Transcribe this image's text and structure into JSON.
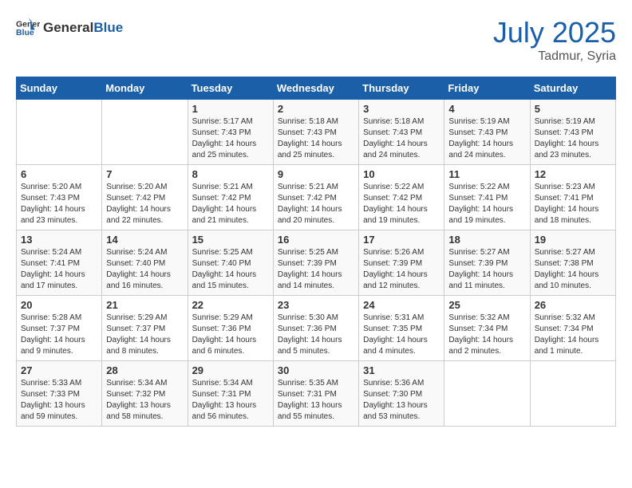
{
  "header": {
    "logo_general": "General",
    "logo_blue": "Blue",
    "month_year": "July 2025",
    "location": "Tadmur, Syria"
  },
  "days_of_week": [
    "Sunday",
    "Monday",
    "Tuesday",
    "Wednesday",
    "Thursday",
    "Friday",
    "Saturday"
  ],
  "weeks": [
    [
      {
        "day": "",
        "sunrise": "",
        "sunset": "",
        "daylight": ""
      },
      {
        "day": "",
        "sunrise": "",
        "sunset": "",
        "daylight": ""
      },
      {
        "day": "1",
        "sunrise": "Sunrise: 5:17 AM",
        "sunset": "Sunset: 7:43 PM",
        "daylight": "Daylight: 14 hours and 25 minutes."
      },
      {
        "day": "2",
        "sunrise": "Sunrise: 5:18 AM",
        "sunset": "Sunset: 7:43 PM",
        "daylight": "Daylight: 14 hours and 25 minutes."
      },
      {
        "day": "3",
        "sunrise": "Sunrise: 5:18 AM",
        "sunset": "Sunset: 7:43 PM",
        "daylight": "Daylight: 14 hours and 24 minutes."
      },
      {
        "day": "4",
        "sunrise": "Sunrise: 5:19 AM",
        "sunset": "Sunset: 7:43 PM",
        "daylight": "Daylight: 14 hours and 24 minutes."
      },
      {
        "day": "5",
        "sunrise": "Sunrise: 5:19 AM",
        "sunset": "Sunset: 7:43 PM",
        "daylight": "Daylight: 14 hours and 23 minutes."
      }
    ],
    [
      {
        "day": "6",
        "sunrise": "Sunrise: 5:20 AM",
        "sunset": "Sunset: 7:43 PM",
        "daylight": "Daylight: 14 hours and 23 minutes."
      },
      {
        "day": "7",
        "sunrise": "Sunrise: 5:20 AM",
        "sunset": "Sunset: 7:42 PM",
        "daylight": "Daylight: 14 hours and 22 minutes."
      },
      {
        "day": "8",
        "sunrise": "Sunrise: 5:21 AM",
        "sunset": "Sunset: 7:42 PM",
        "daylight": "Daylight: 14 hours and 21 minutes."
      },
      {
        "day": "9",
        "sunrise": "Sunrise: 5:21 AM",
        "sunset": "Sunset: 7:42 PM",
        "daylight": "Daylight: 14 hours and 20 minutes."
      },
      {
        "day": "10",
        "sunrise": "Sunrise: 5:22 AM",
        "sunset": "Sunset: 7:42 PM",
        "daylight": "Daylight: 14 hours and 19 minutes."
      },
      {
        "day": "11",
        "sunrise": "Sunrise: 5:22 AM",
        "sunset": "Sunset: 7:41 PM",
        "daylight": "Daylight: 14 hours and 19 minutes."
      },
      {
        "day": "12",
        "sunrise": "Sunrise: 5:23 AM",
        "sunset": "Sunset: 7:41 PM",
        "daylight": "Daylight: 14 hours and 18 minutes."
      }
    ],
    [
      {
        "day": "13",
        "sunrise": "Sunrise: 5:24 AM",
        "sunset": "Sunset: 7:41 PM",
        "daylight": "Daylight: 14 hours and 17 minutes."
      },
      {
        "day": "14",
        "sunrise": "Sunrise: 5:24 AM",
        "sunset": "Sunset: 7:40 PM",
        "daylight": "Daylight: 14 hours and 16 minutes."
      },
      {
        "day": "15",
        "sunrise": "Sunrise: 5:25 AM",
        "sunset": "Sunset: 7:40 PM",
        "daylight": "Daylight: 14 hours and 15 minutes."
      },
      {
        "day": "16",
        "sunrise": "Sunrise: 5:25 AM",
        "sunset": "Sunset: 7:39 PM",
        "daylight": "Daylight: 14 hours and 14 minutes."
      },
      {
        "day": "17",
        "sunrise": "Sunrise: 5:26 AM",
        "sunset": "Sunset: 7:39 PM",
        "daylight": "Daylight: 14 hours and 12 minutes."
      },
      {
        "day": "18",
        "sunrise": "Sunrise: 5:27 AM",
        "sunset": "Sunset: 7:39 PM",
        "daylight": "Daylight: 14 hours and 11 minutes."
      },
      {
        "day": "19",
        "sunrise": "Sunrise: 5:27 AM",
        "sunset": "Sunset: 7:38 PM",
        "daylight": "Daylight: 14 hours and 10 minutes."
      }
    ],
    [
      {
        "day": "20",
        "sunrise": "Sunrise: 5:28 AM",
        "sunset": "Sunset: 7:37 PM",
        "daylight": "Daylight: 14 hours and 9 minutes."
      },
      {
        "day": "21",
        "sunrise": "Sunrise: 5:29 AM",
        "sunset": "Sunset: 7:37 PM",
        "daylight": "Daylight: 14 hours and 8 minutes."
      },
      {
        "day": "22",
        "sunrise": "Sunrise: 5:29 AM",
        "sunset": "Sunset: 7:36 PM",
        "daylight": "Daylight: 14 hours and 6 minutes."
      },
      {
        "day": "23",
        "sunrise": "Sunrise: 5:30 AM",
        "sunset": "Sunset: 7:36 PM",
        "daylight": "Daylight: 14 hours and 5 minutes."
      },
      {
        "day": "24",
        "sunrise": "Sunrise: 5:31 AM",
        "sunset": "Sunset: 7:35 PM",
        "daylight": "Daylight: 14 hours and 4 minutes."
      },
      {
        "day": "25",
        "sunrise": "Sunrise: 5:32 AM",
        "sunset": "Sunset: 7:34 PM",
        "daylight": "Daylight: 14 hours and 2 minutes."
      },
      {
        "day": "26",
        "sunrise": "Sunrise: 5:32 AM",
        "sunset": "Sunset: 7:34 PM",
        "daylight": "Daylight: 14 hours and 1 minute."
      }
    ],
    [
      {
        "day": "27",
        "sunrise": "Sunrise: 5:33 AM",
        "sunset": "Sunset: 7:33 PM",
        "daylight": "Daylight: 13 hours and 59 minutes."
      },
      {
        "day": "28",
        "sunrise": "Sunrise: 5:34 AM",
        "sunset": "Sunset: 7:32 PM",
        "daylight": "Daylight: 13 hours and 58 minutes."
      },
      {
        "day": "29",
        "sunrise": "Sunrise: 5:34 AM",
        "sunset": "Sunset: 7:31 PM",
        "daylight": "Daylight: 13 hours and 56 minutes."
      },
      {
        "day": "30",
        "sunrise": "Sunrise: 5:35 AM",
        "sunset": "Sunset: 7:31 PM",
        "daylight": "Daylight: 13 hours and 55 minutes."
      },
      {
        "day": "31",
        "sunrise": "Sunrise: 5:36 AM",
        "sunset": "Sunset: 7:30 PM",
        "daylight": "Daylight: 13 hours and 53 minutes."
      },
      {
        "day": "",
        "sunrise": "",
        "sunset": "",
        "daylight": ""
      },
      {
        "day": "",
        "sunrise": "",
        "sunset": "",
        "daylight": ""
      }
    ]
  ]
}
